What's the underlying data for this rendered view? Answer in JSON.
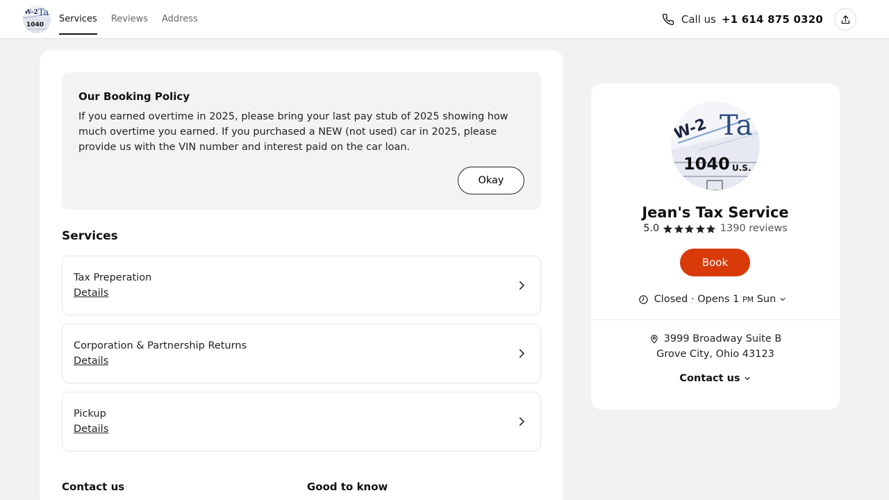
{
  "header": {
    "tabs": [
      {
        "label": "Services",
        "active": true
      },
      {
        "label": "Reviews",
        "active": false
      },
      {
        "label": "Address",
        "active": false
      }
    ],
    "call_label": "Call us",
    "phone": "+1 614 875 0320",
    "icons": {
      "phone": "phone-icon",
      "share": "share-icon",
      "logo": "tax-forms-logo"
    }
  },
  "policy": {
    "title": "Our Booking Policy",
    "text": "If you earned overtime in 2025, please bring your last pay stub of 2025 showing how much overtime you earned. If you purchased a NEW (not used) car in 2025, please provide us with the VIN number and interest paid on the car loan.",
    "okay_label": "Okay"
  },
  "services": {
    "title": "Services",
    "items": [
      {
        "name": "Tax Preperation",
        "link": "Details"
      },
      {
        "name": "Corporation & Partnership Returns",
        "link": "Details"
      },
      {
        "name": "Pickup",
        "link": "Details"
      }
    ]
  },
  "footer_sections": {
    "contact": "Contact us",
    "good_to_know": "Good to know"
  },
  "business": {
    "name": "Jean's Tax Service",
    "rating": "5.0",
    "stars": 5,
    "reviews": "1390 reviews",
    "book_label": "Book",
    "status": "Closed",
    "opens_prefix": "· Opens 1",
    "opens_pm": "PM",
    "opens_day": "Sun",
    "address_line1": "3999 Broadway Suite B",
    "address_line2": "Grove City, Ohio 43123",
    "contact_label": "Contact us",
    "colors": {
      "book": "#d83a0a",
      "star": "#222222"
    }
  }
}
